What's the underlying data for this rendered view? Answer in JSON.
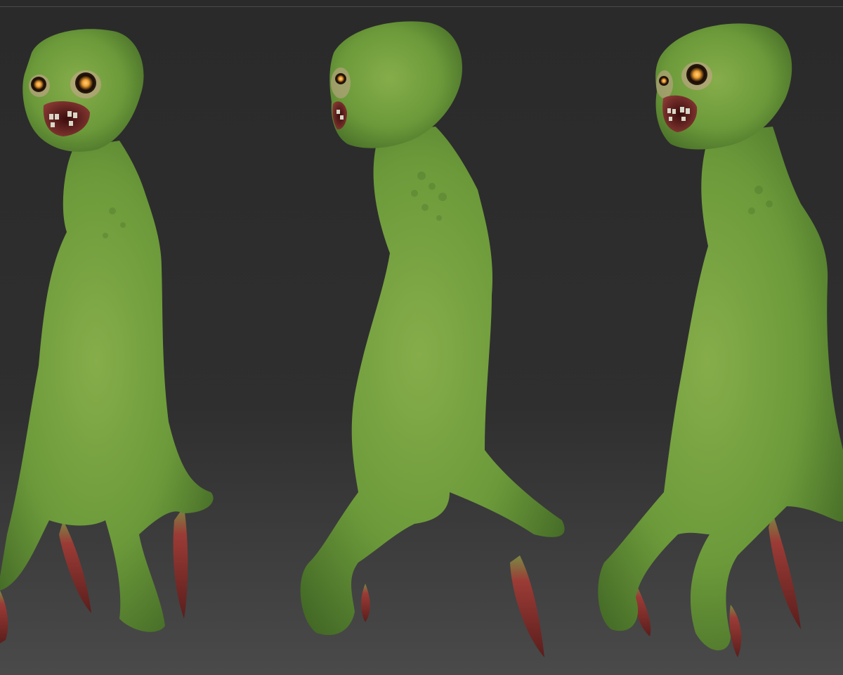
{
  "scene": {
    "background_top": "#2a2a2a",
    "background_bottom": "#4a4a4a",
    "skin_light": "#86ad4a",
    "skin_mid": "#6c9a3a",
    "skin_dark": "#3f6424",
    "claw_red": "#9b3b36",
    "claw_dark": "#5a1e1c",
    "eye_glow": "#f0a030",
    "figure_count": 3
  }
}
